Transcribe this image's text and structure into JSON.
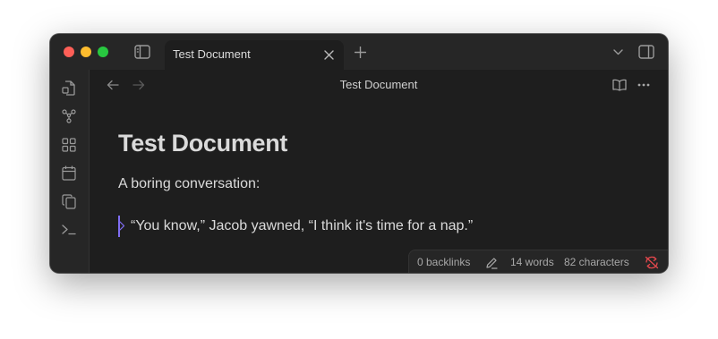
{
  "tab": {
    "title": "Test Document"
  },
  "navbar": {
    "title": "Test Document"
  },
  "document": {
    "heading": "Test Document",
    "paragraph": "A boring conversation:",
    "blockquote": "“You know,” Jacob yawned, “I think it's time for a nap.”"
  },
  "status": {
    "backlinks": "0 backlinks",
    "words": "14 words",
    "characters": "82 characters"
  },
  "colors": {
    "accent": "#7f6df2",
    "sync_error": "#e5484d"
  }
}
